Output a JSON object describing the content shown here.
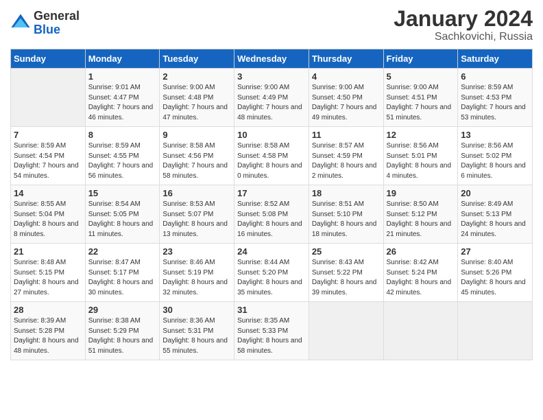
{
  "header": {
    "logo_general": "General",
    "logo_blue": "Blue",
    "month_title": "January 2024",
    "location": "Sachkovichi, Russia"
  },
  "days_of_week": [
    "Sunday",
    "Monday",
    "Tuesday",
    "Wednesday",
    "Thursday",
    "Friday",
    "Saturday"
  ],
  "weeks": [
    [
      {
        "day": "",
        "sunrise": "",
        "sunset": "",
        "daylight": "",
        "empty": true
      },
      {
        "day": "1",
        "sunrise": "Sunrise: 9:01 AM",
        "sunset": "Sunset: 4:47 PM",
        "daylight": "Daylight: 7 hours and 46 minutes."
      },
      {
        "day": "2",
        "sunrise": "Sunrise: 9:00 AM",
        "sunset": "Sunset: 4:48 PM",
        "daylight": "Daylight: 7 hours and 47 minutes."
      },
      {
        "day": "3",
        "sunrise": "Sunrise: 9:00 AM",
        "sunset": "Sunset: 4:49 PM",
        "daylight": "Daylight: 7 hours and 48 minutes."
      },
      {
        "day": "4",
        "sunrise": "Sunrise: 9:00 AM",
        "sunset": "Sunset: 4:50 PM",
        "daylight": "Daylight: 7 hours and 49 minutes."
      },
      {
        "day": "5",
        "sunrise": "Sunrise: 9:00 AM",
        "sunset": "Sunset: 4:51 PM",
        "daylight": "Daylight: 7 hours and 51 minutes."
      },
      {
        "day": "6",
        "sunrise": "Sunrise: 8:59 AM",
        "sunset": "Sunset: 4:53 PM",
        "daylight": "Daylight: 7 hours and 53 minutes."
      }
    ],
    [
      {
        "day": "7",
        "sunrise": "Sunrise: 8:59 AM",
        "sunset": "Sunset: 4:54 PM",
        "daylight": "Daylight: 7 hours and 54 minutes."
      },
      {
        "day": "8",
        "sunrise": "Sunrise: 8:59 AM",
        "sunset": "Sunset: 4:55 PM",
        "daylight": "Daylight: 7 hours and 56 minutes."
      },
      {
        "day": "9",
        "sunrise": "Sunrise: 8:58 AM",
        "sunset": "Sunset: 4:56 PM",
        "daylight": "Daylight: 7 hours and 58 minutes."
      },
      {
        "day": "10",
        "sunrise": "Sunrise: 8:58 AM",
        "sunset": "Sunset: 4:58 PM",
        "daylight": "Daylight: 8 hours and 0 minutes."
      },
      {
        "day": "11",
        "sunrise": "Sunrise: 8:57 AM",
        "sunset": "Sunset: 4:59 PM",
        "daylight": "Daylight: 8 hours and 2 minutes."
      },
      {
        "day": "12",
        "sunrise": "Sunrise: 8:56 AM",
        "sunset": "Sunset: 5:01 PM",
        "daylight": "Daylight: 8 hours and 4 minutes."
      },
      {
        "day": "13",
        "sunrise": "Sunrise: 8:56 AM",
        "sunset": "Sunset: 5:02 PM",
        "daylight": "Daylight: 8 hours and 6 minutes."
      }
    ],
    [
      {
        "day": "14",
        "sunrise": "Sunrise: 8:55 AM",
        "sunset": "Sunset: 5:04 PM",
        "daylight": "Daylight: 8 hours and 8 minutes."
      },
      {
        "day": "15",
        "sunrise": "Sunrise: 8:54 AM",
        "sunset": "Sunset: 5:05 PM",
        "daylight": "Daylight: 8 hours and 11 minutes."
      },
      {
        "day": "16",
        "sunrise": "Sunrise: 8:53 AM",
        "sunset": "Sunset: 5:07 PM",
        "daylight": "Daylight: 8 hours and 13 minutes."
      },
      {
        "day": "17",
        "sunrise": "Sunrise: 8:52 AM",
        "sunset": "Sunset: 5:08 PM",
        "daylight": "Daylight: 8 hours and 16 minutes."
      },
      {
        "day": "18",
        "sunrise": "Sunrise: 8:51 AM",
        "sunset": "Sunset: 5:10 PM",
        "daylight": "Daylight: 8 hours and 18 minutes."
      },
      {
        "day": "19",
        "sunrise": "Sunrise: 8:50 AM",
        "sunset": "Sunset: 5:12 PM",
        "daylight": "Daylight: 8 hours and 21 minutes."
      },
      {
        "day": "20",
        "sunrise": "Sunrise: 8:49 AM",
        "sunset": "Sunset: 5:13 PM",
        "daylight": "Daylight: 8 hours and 24 minutes."
      }
    ],
    [
      {
        "day": "21",
        "sunrise": "Sunrise: 8:48 AM",
        "sunset": "Sunset: 5:15 PM",
        "daylight": "Daylight: 8 hours and 27 minutes."
      },
      {
        "day": "22",
        "sunrise": "Sunrise: 8:47 AM",
        "sunset": "Sunset: 5:17 PM",
        "daylight": "Daylight: 8 hours and 30 minutes."
      },
      {
        "day": "23",
        "sunrise": "Sunrise: 8:46 AM",
        "sunset": "Sunset: 5:19 PM",
        "daylight": "Daylight: 8 hours and 32 minutes."
      },
      {
        "day": "24",
        "sunrise": "Sunrise: 8:44 AM",
        "sunset": "Sunset: 5:20 PM",
        "daylight": "Daylight: 8 hours and 35 minutes."
      },
      {
        "day": "25",
        "sunrise": "Sunrise: 8:43 AM",
        "sunset": "Sunset: 5:22 PM",
        "daylight": "Daylight: 8 hours and 39 minutes."
      },
      {
        "day": "26",
        "sunrise": "Sunrise: 8:42 AM",
        "sunset": "Sunset: 5:24 PM",
        "daylight": "Daylight: 8 hours and 42 minutes."
      },
      {
        "day": "27",
        "sunrise": "Sunrise: 8:40 AM",
        "sunset": "Sunset: 5:26 PM",
        "daylight": "Daylight: 8 hours and 45 minutes."
      }
    ],
    [
      {
        "day": "28",
        "sunrise": "Sunrise: 8:39 AM",
        "sunset": "Sunset: 5:28 PM",
        "daylight": "Daylight: 8 hours and 48 minutes."
      },
      {
        "day": "29",
        "sunrise": "Sunrise: 8:38 AM",
        "sunset": "Sunset: 5:29 PM",
        "daylight": "Daylight: 8 hours and 51 minutes."
      },
      {
        "day": "30",
        "sunrise": "Sunrise: 8:36 AM",
        "sunset": "Sunset: 5:31 PM",
        "daylight": "Daylight: 8 hours and 55 minutes."
      },
      {
        "day": "31",
        "sunrise": "Sunrise: 8:35 AM",
        "sunset": "Sunset: 5:33 PM",
        "daylight": "Daylight: 8 hours and 58 minutes."
      },
      {
        "day": "",
        "sunrise": "",
        "sunset": "",
        "daylight": "",
        "empty": true
      },
      {
        "day": "",
        "sunrise": "",
        "sunset": "",
        "daylight": "",
        "empty": true
      },
      {
        "day": "",
        "sunrise": "",
        "sunset": "",
        "daylight": "",
        "empty": true
      }
    ]
  ]
}
